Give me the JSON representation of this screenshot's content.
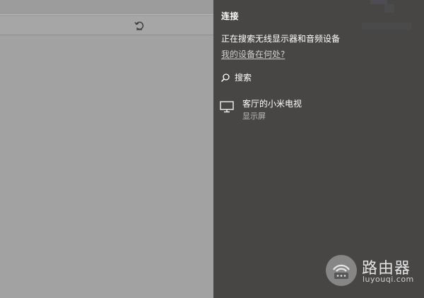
{
  "panel": {
    "title": "连接",
    "status": "正在搜索无线显示器和音频设备",
    "help_link": "我的设备在何处?",
    "search_label": "搜索",
    "device": {
      "name": "客厅的小米电视",
      "type": "显示屏",
      "icon": "monitor-icon"
    }
  },
  "watermark": {
    "title": "路由器",
    "url": "luyouqi.com"
  },
  "icons": {
    "refresh": "refresh-icon",
    "search": "search-icon",
    "watermark_logo": "router-logo-icon"
  },
  "colors": {
    "panel_bg": "#474645",
    "background_dim": "#a2a2a2",
    "text_primary": "#ffffff",
    "text_secondary": "#bdbdbd"
  }
}
